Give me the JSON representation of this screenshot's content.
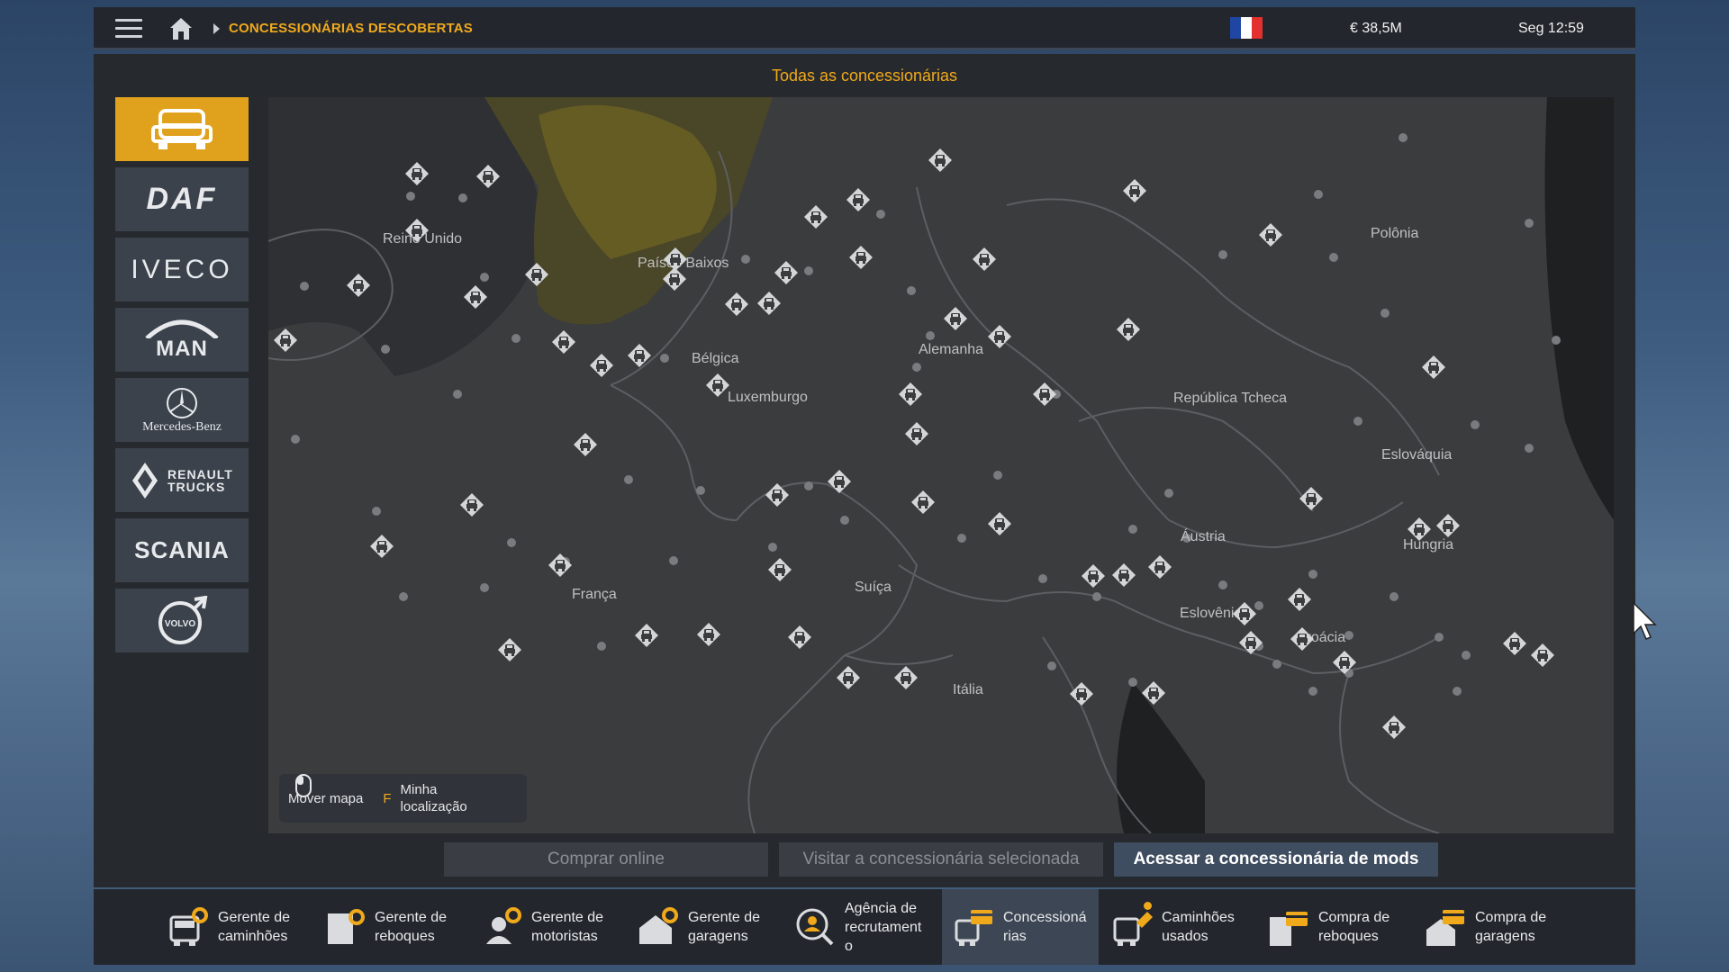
{
  "topbar": {
    "breadcrumb": "CONCESSIONÁRIAS DESCOBERTAS",
    "money": "€ 38,5M",
    "time": "Seg 12:59",
    "flag_colors": [
      "#1f46a3",
      "#ffffff",
      "#e2312f"
    ]
  },
  "panel": {
    "title": "Todas as concessionárias"
  },
  "brands": [
    {
      "name": "all-trucks",
      "label": "",
      "active": true
    },
    {
      "name": "daf",
      "label": "DAF"
    },
    {
      "name": "iveco",
      "label": "IVECO"
    },
    {
      "name": "man",
      "label": "MAN"
    },
    {
      "name": "mercedes-benz",
      "label": "Mercedes-Benz"
    },
    {
      "name": "renault-trucks",
      "label": "RENAULT TRUCKS"
    },
    {
      "name": "scania",
      "label": "SCANIA"
    },
    {
      "name": "volvo",
      "label": "VOLVO"
    }
  ],
  "map": {
    "countries": [
      "Reino Unido",
      "Países Baixos",
      "Bélgica",
      "Luxemburgo",
      "Alemanha",
      "Polônia",
      "República Tcheca",
      "Eslováquia",
      "Áustria",
      "Hungria",
      "França",
      "Suíça",
      "Eslovênia",
      "Croácia",
      "Itália"
    ]
  },
  "hint": {
    "move_label": "Mover mapa",
    "key": "F",
    "location_label_1": "Minha",
    "location_label_2": "localização"
  },
  "actions": {
    "buy_online": "Comprar online",
    "visit_selected": "Visitar a concessionária selecionada",
    "mods_dealer": "Acessar a concessionária de mods"
  },
  "bottom_nav": [
    {
      "label": "Gerente de\ncaminhões",
      "icon": "truck-manager-icon"
    },
    {
      "label": "Gerente de\nreboques",
      "icon": "trailer-manager-icon"
    },
    {
      "label": "Gerente de\nmotoristas",
      "icon": "driver-manager-icon"
    },
    {
      "label": "Gerente de\ngaragens",
      "icon": "garage-manager-icon"
    },
    {
      "label": "Agência de\nrecrutament\no",
      "icon": "recruitment-icon"
    },
    {
      "label": "Concessioná\nrias",
      "icon": "dealer-icon",
      "active": true
    },
    {
      "label": "Caminhões\nusados",
      "icon": "used-trucks-icon"
    },
    {
      "label": "Compra de\nreboques",
      "icon": "buy-trailers-icon"
    },
    {
      "label": "Compra de\ngaragens",
      "icon": "buy-garages-icon"
    }
  ],
  "colors": {
    "accent": "#f0a91b"
  }
}
